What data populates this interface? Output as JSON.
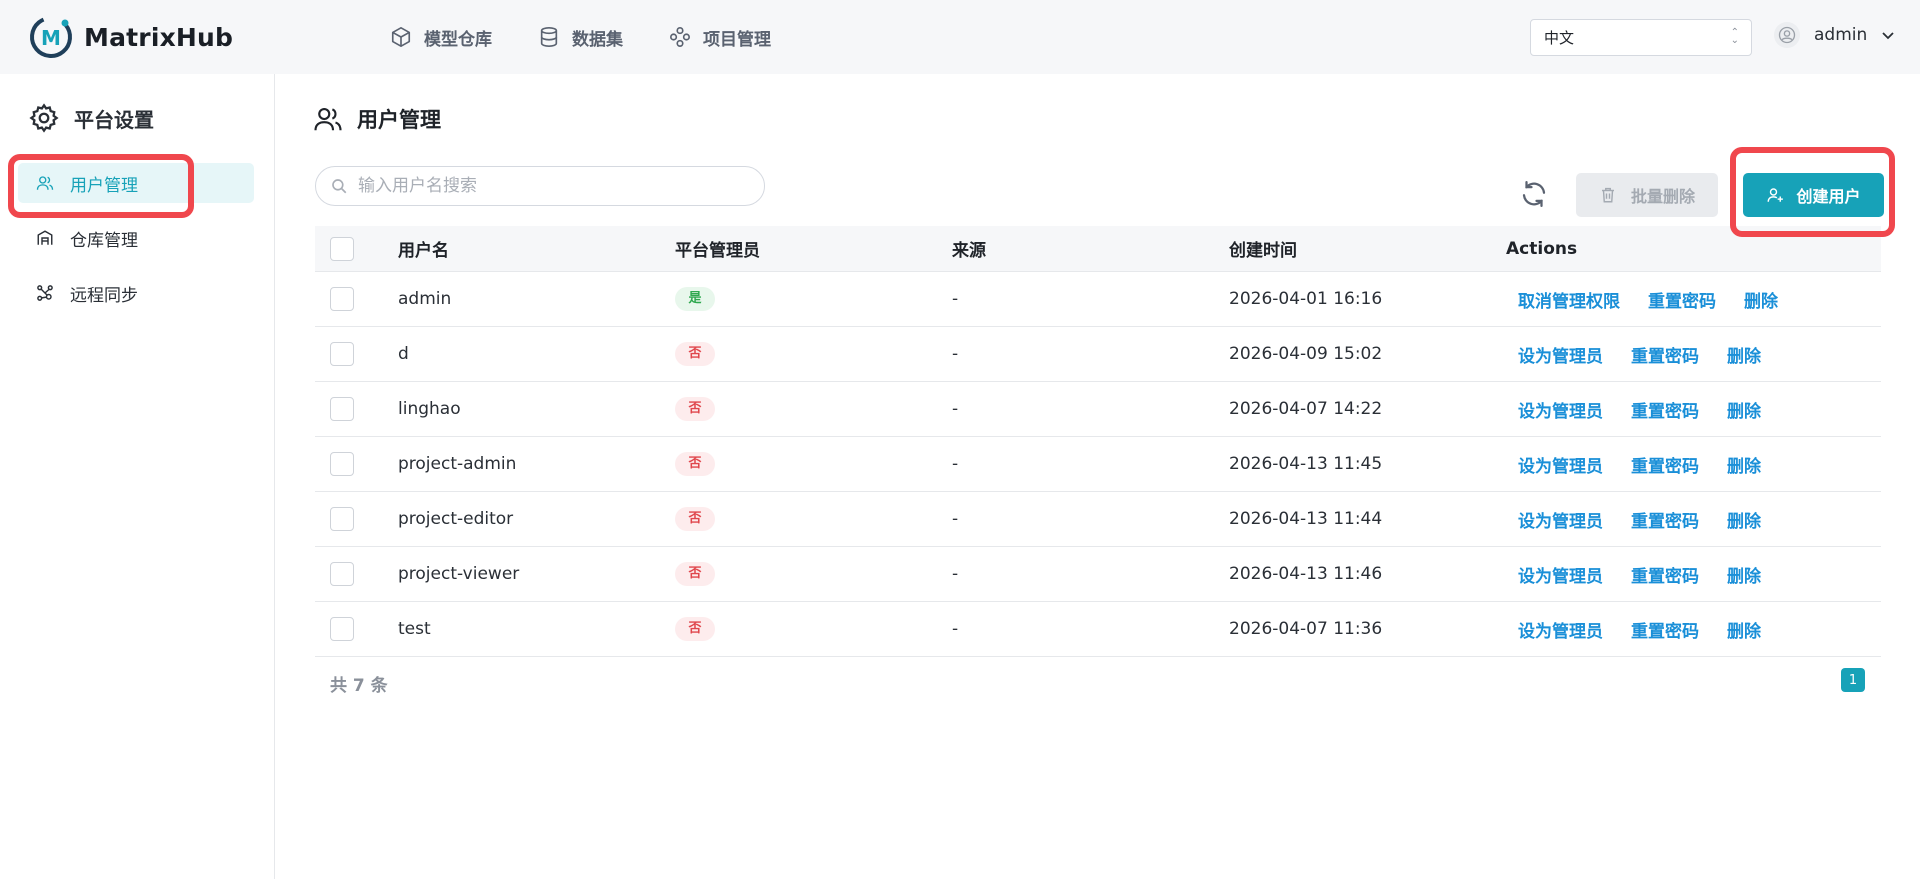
{
  "app": {
    "name": "MatrixHub"
  },
  "topnav": [
    {
      "label": "模型仓库",
      "icon": "cube-icon"
    },
    {
      "label": "数据集",
      "icon": "database-icon"
    },
    {
      "label": "项目管理",
      "icon": "project-icon"
    }
  ],
  "language": {
    "selected": "中文"
  },
  "user": {
    "name": "admin"
  },
  "sidebar": {
    "title": "平台设置",
    "items": [
      {
        "label": "用户管理",
        "icon": "users-icon",
        "active": true
      },
      {
        "label": "仓库管理",
        "icon": "warehouse-icon",
        "active": false
      },
      {
        "label": "远程同步",
        "icon": "sync-nodes-icon",
        "active": false
      }
    ]
  },
  "page": {
    "title": "用户管理",
    "search_placeholder": "输入用户名搜索",
    "bulk_delete_label": "批量删除",
    "create_label": "创建用户"
  },
  "table": {
    "headers": {
      "name": "用户名",
      "admin": "平台管理员",
      "source": "来源",
      "created": "创建时间",
      "actions": "Actions"
    },
    "rows": [
      {
        "name": "admin",
        "admin": "是",
        "is_admin": true,
        "source": "-",
        "created": "2026-04-01 16:16",
        "toggle_label": "取消管理权限"
      },
      {
        "name": "d",
        "admin": "否",
        "is_admin": false,
        "source": "-",
        "created": "2026-04-09 15:02",
        "toggle_label": "设为管理员"
      },
      {
        "name": "linghao",
        "admin": "否",
        "is_admin": false,
        "source": "-",
        "created": "2026-04-07 14:22",
        "toggle_label": "设为管理员"
      },
      {
        "name": "project-admin",
        "admin": "否",
        "is_admin": false,
        "source": "-",
        "created": "2026-04-13 11:45",
        "toggle_label": "设为管理员"
      },
      {
        "name": "project-editor",
        "admin": "否",
        "is_admin": false,
        "source": "-",
        "created": "2026-04-13 11:44",
        "toggle_label": "设为管理员"
      },
      {
        "name": "project-viewer",
        "admin": "否",
        "is_admin": false,
        "source": "-",
        "created": "2026-04-13 11:46",
        "toggle_label": "设为管理员"
      },
      {
        "name": "test",
        "admin": "否",
        "is_admin": false,
        "source": "-",
        "created": "2026-04-07 11:36",
        "toggle_label": "设为管理员"
      }
    ],
    "reset_label": "重置密码",
    "delete_label": "删除"
  },
  "footer": {
    "total": "共 7 条",
    "page": "1"
  },
  "colors": {
    "accent": "#17a2b8",
    "link": "#1a8fd8",
    "highlight": "#f0474d",
    "yes": "#2fa84f",
    "no": "#e0474d"
  }
}
